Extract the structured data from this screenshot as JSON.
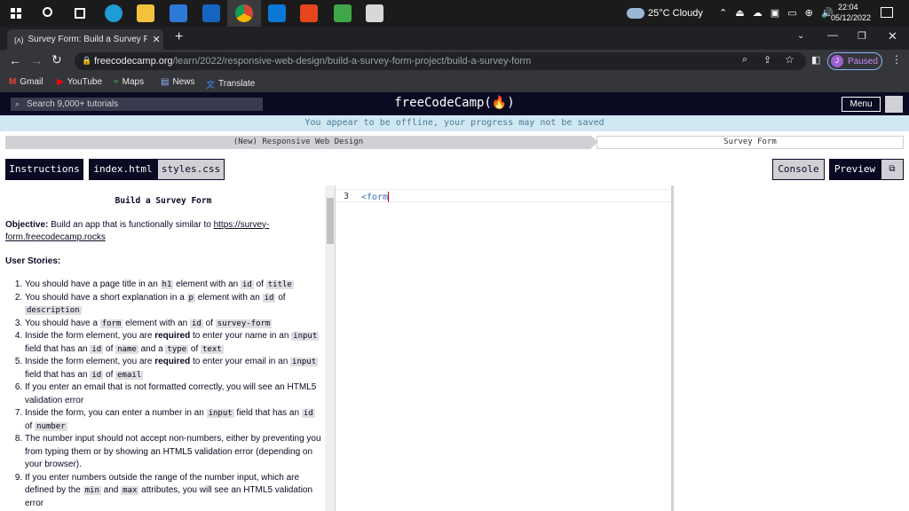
{
  "taskbar": {
    "weather": "25°C  Cloudy",
    "time": "22:04",
    "date": "05/12/2022"
  },
  "browser": {
    "tab_title": "Survey Form: Build a Survey Form",
    "url_domain": "freecodecamp.org",
    "url_path": "/learn/2022/responsive-web-design/build-a-survey-form-project/build-a-survey-form",
    "profile": "Paused",
    "profile_initial": "J"
  },
  "bookmarks": [
    "Gmail",
    "YouTube",
    "Maps",
    "News",
    "Translate"
  ],
  "nav": {
    "search_placeholder": "Search 9,000+ tutorials",
    "logo": "freeCodeCamp(🔥)",
    "menu": "Menu"
  },
  "offline_msg": "You appear to be offline, your progress may not be saved",
  "breadcrumbs": [
    "(New) Responsive Web Design",
    "Survey Form"
  ],
  "tabs": {
    "instructions": "Instructions",
    "index": "index.html",
    "styles": "styles.css",
    "console": "Console",
    "preview": "Preview"
  },
  "instructions": {
    "title": "Build a Survey Form",
    "objective_label": "Objective:",
    "objective_text": " Build an app that is functionally similar to ",
    "objective_link": "https://survey-form.freecodecamp.rocks",
    "user_stories": "User Stories:"
  },
  "editor": {
    "line": "3",
    "code": "<form"
  }
}
